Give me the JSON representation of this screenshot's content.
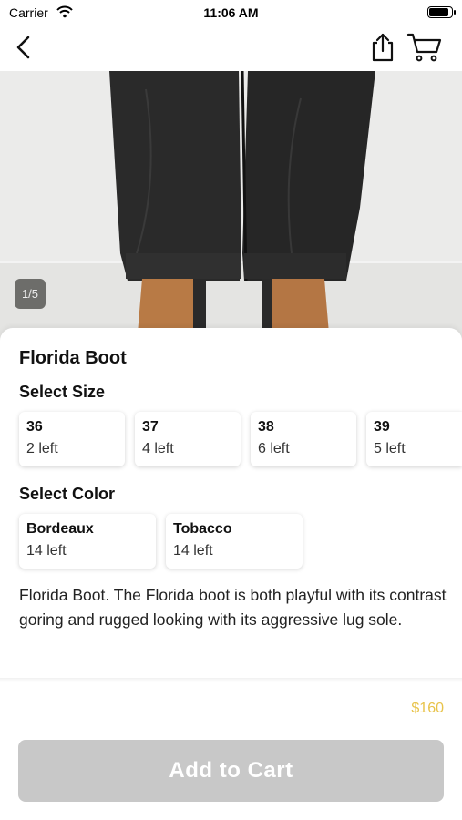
{
  "status_bar": {
    "carrier": "Carrier",
    "time": "11:06 AM",
    "battery_level": 0.9
  },
  "nav": {
    "back_icon": "chevron-left-icon",
    "share_icon": "share-icon",
    "cart_icon": "cart-icon"
  },
  "gallery": {
    "page_indicator": "1/5"
  },
  "product": {
    "title": "Florida Boot",
    "size_section_label": "Select Size",
    "sizes": [
      {
        "size": "36",
        "stock": "2 left"
      },
      {
        "size": "37",
        "stock": "4 left"
      },
      {
        "size": "38",
        "stock": "6 left"
      },
      {
        "size": "39",
        "stock": "5 left"
      }
    ],
    "color_section_label": "Select Color",
    "colors": [
      {
        "name": "Bordeaux",
        "stock": "14 left"
      },
      {
        "name": "Tobacco",
        "stock": "14 left"
      }
    ],
    "description": "Florida Boot. The Florida boot is both playful with its contrast goring and rugged looking with its aggressive lug sole.",
    "price": "$160",
    "add_to_cart_label": "Add to Cart"
  },
  "colors": {
    "price": "#e8c34a",
    "button_disabled": "#c8c8c8"
  }
}
